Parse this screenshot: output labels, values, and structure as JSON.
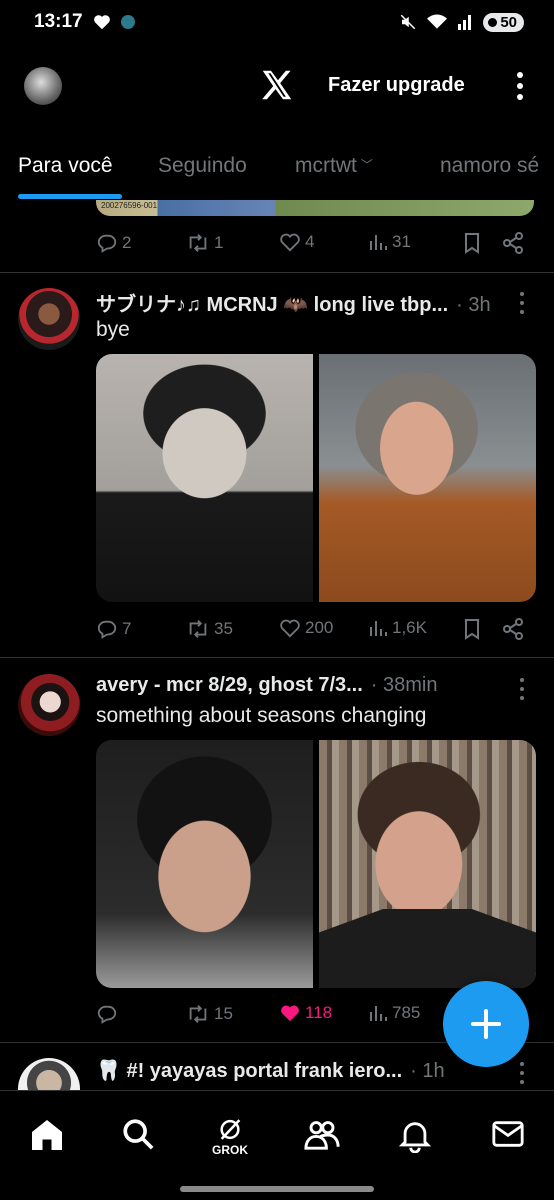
{
  "status_bar": {
    "time": "13:17",
    "battery": "50"
  },
  "header": {
    "upgrade_label": "Fazer upgrade"
  },
  "tabs": [
    {
      "label": "Para você",
      "active": true
    },
    {
      "label": "Seguindo",
      "active": false
    },
    {
      "label": "mcrtwt",
      "active": false
    },
    {
      "label": "namoro sé",
      "active": false
    }
  ],
  "previous_post": {
    "image_tag": "200276596-001",
    "replies": "2",
    "reposts": "1",
    "likes": "4",
    "views": "31"
  },
  "posts": [
    {
      "author": "サブリナ♪♫ MCRNJ 🦇 long live tbp...",
      "time": "3h",
      "text": "bye",
      "replies": "7",
      "reposts": "35",
      "likes": "200",
      "views": "1,6K",
      "liked": false
    },
    {
      "author": "avery - mcr 8/29, ghost 7/3...",
      "time": "38min",
      "text": "something about seasons changing",
      "replies": "",
      "reposts": "15",
      "likes": "118",
      "views": "785",
      "liked": true
    },
    {
      "author": "🦷 #! yayayas portal frank iero...",
      "time": "1h"
    }
  ],
  "nav": {
    "grok_label": "GROK"
  },
  "colors": {
    "accent": "#1d9bf0",
    "like": "#f91880",
    "muted": "#71767b",
    "background": "#000000"
  }
}
